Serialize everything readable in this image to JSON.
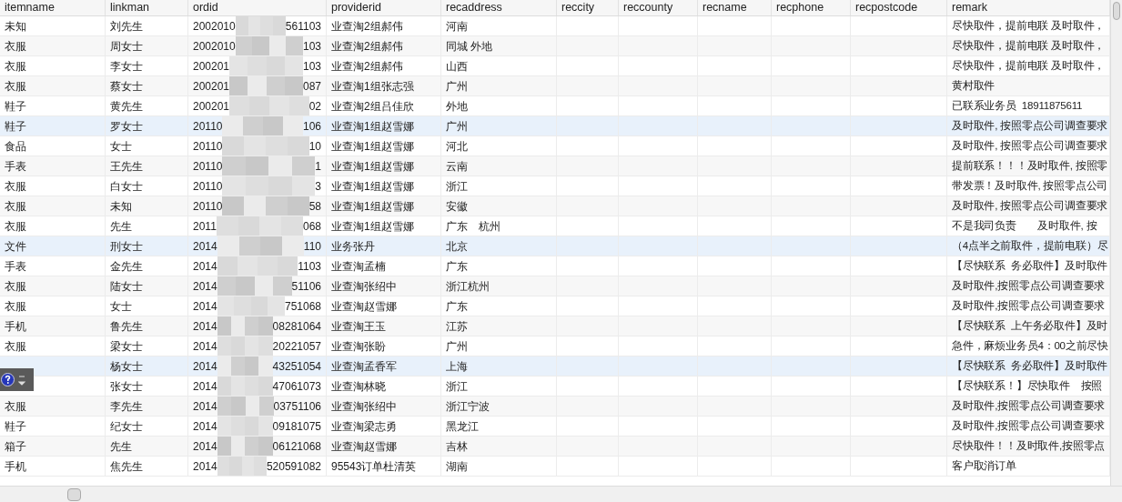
{
  "columns": [
    "itemname",
    "linkman",
    "ordid",
    "providerid",
    "recaddress",
    "reccity",
    "reccounty",
    "recname",
    "recphone",
    "recpostcode",
    "remark"
  ],
  "rows": [
    {
      "itemname": "未知",
      "linkman": "刘先生",
      "ordid_start": "2002010",
      "ordid_end": "561103",
      "providerid": "业查淘2组郝伟",
      "recaddress": "河南",
      "remark": "尽快取件，提前电联 及时取件，",
      "highlighted": false
    },
    {
      "itemname": "衣服",
      "linkman": "周女士",
      "ordid_start": "2002010",
      "ordid_end": "103",
      "providerid": "业查淘2组郝伟",
      "recaddress": "同城 外地",
      "remark": "尽快取件，提前电联 及时取件，",
      "highlighted": false
    },
    {
      "itemname": "衣服",
      "linkman": "李女士",
      "ordid_start": "200201",
      "ordid_end": "103",
      "providerid": "业查淘2组郝伟",
      "recaddress": "山西",
      "remark": "尽快取件，提前电联 及时取件，",
      "highlighted": false
    },
    {
      "itemname": "衣服",
      "linkman": "蔡女士",
      "ordid_start": "200201",
      "ordid_end": "087",
      "providerid": "业查淘1组张志强",
      "recaddress": "广州",
      "remark": "黄村取件",
      "highlighted": false
    },
    {
      "itemname": "鞋子",
      "linkman": "黄先生",
      "ordid_start": "200201",
      "ordid_end": "02",
      "providerid": "业查淘2组吕佳欣",
      "recaddress": "外地",
      "remark": "已联系业务员  18911875611",
      "highlighted": false
    },
    {
      "itemname": "鞋子",
      "linkman": "罗女士",
      "ordid_start": "20110",
      "ordid_end": "106",
      "providerid": "业查淘1组赵雪娜",
      "recaddress": "广州",
      "remark": "及时取件, 按照零点公司调查要求",
      "highlighted": true
    },
    {
      "itemname": "食品",
      "linkman": "女士",
      "ordid_start": "20110",
      "ordid_end": "10",
      "providerid": "业查淘1组赵雪娜",
      "recaddress": "河北",
      "remark": "及时取件, 按照零点公司调查要求",
      "highlighted": false
    },
    {
      "itemname": "手表",
      "linkman": "王先生",
      "ordid_start": "20110",
      "ordid_end": "1",
      "providerid": "业查淘1组赵雪娜",
      "recaddress": "云南",
      "remark": "提前联系！！！及时取件, 按照零",
      "highlighted": false
    },
    {
      "itemname": "衣服",
      "linkman": "白女士",
      "ordid_start": "20110",
      "ordid_end": "3",
      "providerid": "业查淘1组赵雪娜",
      "recaddress": "浙江",
      "remark": "带发票！及时取件, 按照零点公司",
      "highlighted": false
    },
    {
      "itemname": "衣服",
      "linkman": "未知",
      "ordid_start": "20110",
      "ordid_end": "58",
      "providerid": "业查淘1组赵雪娜",
      "recaddress": "安徽",
      "remark": "及时取件, 按照零点公司调查要求",
      "highlighted": false
    },
    {
      "itemname": "衣服",
      "linkman": "先生",
      "ordid_start": "2011",
      "ordid_end": "068",
      "providerid": "业查淘1组赵雪娜",
      "recaddress": "广东　杭州",
      "remark": "不是我司负责　　及时取件, 按",
      "highlighted": false
    },
    {
      "itemname": "文件",
      "linkman": "刑女士",
      "ordid_start": "2014",
      "ordid_end": "110",
      "providerid": "业务张丹",
      "recaddress": "北京",
      "remark": "（4点半之前取件，提前电联）尽",
      "highlighted": true
    },
    {
      "itemname": "手表",
      "linkman": "金先生",
      "ordid_start": "2014",
      "ordid_end": "1103",
      "providerid": "业查淘孟楠",
      "recaddress": "广东",
      "remark": "【尽快联系  务必取件】及时取件",
      "highlighted": false
    },
    {
      "itemname": "衣服",
      "linkman": "陆女士",
      "ordid_start": "2014",
      "ordid_end": "51106",
      "providerid": "业查淘张绍中",
      "recaddress": "浙江杭州",
      "remark": "及时取件,按照零点公司调查要求",
      "highlighted": false
    },
    {
      "itemname": "衣服",
      "linkman": "女士",
      "ordid_start": "2014",
      "ordid_end": "751068",
      "providerid": "业查淘赵雪娜",
      "recaddress": "广东",
      "remark": "及时取件,按照零点公司调查要求",
      "highlighted": false
    },
    {
      "itemname": "手机",
      "linkman": "鲁先生",
      "ordid_start": "2014",
      "ordid_end": "08281064",
      "providerid": "业查淘王玉",
      "recaddress": "江苏",
      "remark": "【尽快联系  上午务必取件】及时",
      "highlighted": false
    },
    {
      "itemname": "衣服",
      "linkman": "梁女士",
      "ordid_start": "2014",
      "ordid_end": "20221057",
      "providerid": "业查淘张盼",
      "recaddress": "广州",
      "remark": "急件，麻烦业务员4：00之前尽快",
      "highlighted": false
    },
    {
      "linkman": "杨女士",
      "ordid_start": "2014",
      "ordid_end": "43251054",
      "providerid": "业查淘孟香军",
      "recaddress": "上海",
      "remark": "【尽快联系  务必取件】及时取件",
      "highlighted": true
    },
    {
      "linkman": "张女士",
      "ordid_start": "2014",
      "ordid_end": "47061073",
      "providerid": "业查淘林晓",
      "recaddress": "浙江",
      "remark": "【尽快联系！】尽快取件　按照",
      "highlighted": false
    },
    {
      "itemname": "衣服",
      "linkman": "李先生",
      "ordid_start": "2014",
      "ordid_end": "03751106",
      "providerid": "业查淘张绍中",
      "recaddress": "浙江宁波",
      "remark": "及时取件,按照零点公司调查要求",
      "highlighted": false
    },
    {
      "itemname": "鞋子",
      "linkman": "纪女士",
      "ordid_start": "2014",
      "ordid_end": "09181075",
      "providerid": "业查淘梁志勇",
      "recaddress": "黑龙江",
      "remark": "及时取件,按照零点公司调查要求",
      "highlighted": false
    },
    {
      "itemname": "箱子",
      "linkman": "先生",
      "ordid_start": "2014",
      "ordid_end": "06121068",
      "providerid": "业查淘赵雪娜",
      "recaddress": "吉林",
      "remark": "尽快取件！！及时取件,按照零点",
      "highlighted": false
    },
    {
      "itemname": "手机",
      "linkman": "焦先生",
      "ordid_start": "2014",
      "ordid_end": "520591082",
      "providerid": "95543订单杜清英",
      "recaddress": "湖南",
      "remark": "客户取消订单",
      "highlighted": false
    }
  ]
}
